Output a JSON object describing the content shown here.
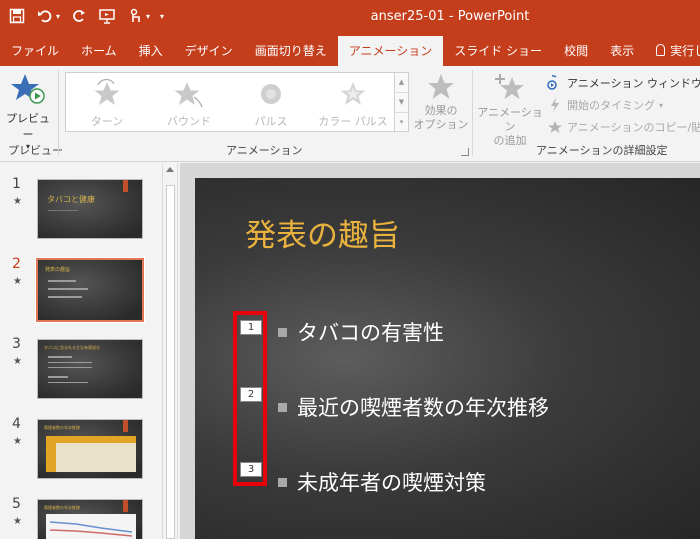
{
  "window": {
    "title": "anser25-01 - PowerPoint"
  },
  "tabs": [
    "ファイル",
    "ホーム",
    "挿入",
    "デザイン",
    "画面切り替え",
    "アニメーション",
    "スライド ショー",
    "校閲",
    "表示",
    "実行したい"
  ],
  "active_tab_index": 5,
  "ribbon": {
    "preview_label": "プレビュー",
    "preview_group": "プレビュー",
    "gallery_items": [
      "ターン",
      "バウンド",
      "パルス",
      "カラー パルス"
    ],
    "effect_options": [
      "効果の",
      "オプション"
    ],
    "animation_group": "アニメーション",
    "add_animation": [
      "アニメーション",
      "の追加"
    ],
    "pane_label": "アニメーション ウィンドウ",
    "trigger_label": "開始のタイミング",
    "painter_label": "アニメーションのコピー/貼り付け",
    "advanced_group": "アニメーションの詳細設定"
  },
  "thumbnails": [
    {
      "number": "1",
      "title": "タバコと健康",
      "sub": ""
    },
    {
      "number": "2",
      "title": "発表の趣旨",
      "sub": ""
    },
    {
      "number": "3",
      "title": "タバコに含まれる主な有害成分",
      "sub": ""
    },
    {
      "number": "4",
      "title": "喫煙者数の年次推移",
      "sub": ""
    },
    {
      "number": "5",
      "title": "喫煙者数の年次推移",
      "sub": ""
    }
  ],
  "active_slide_index": 1,
  "slide": {
    "title": "発表の趣旨",
    "bullets": [
      "タバコの有害性",
      "最近の喫煙者数の年次推移",
      "未成年者の喫煙対策"
    ],
    "animation_tags": [
      "1",
      "2",
      "3"
    ]
  },
  "colors": {
    "accent": "#c43e1c",
    "slide_title": "#e9b23e",
    "highlight": "#e8000a"
  }
}
